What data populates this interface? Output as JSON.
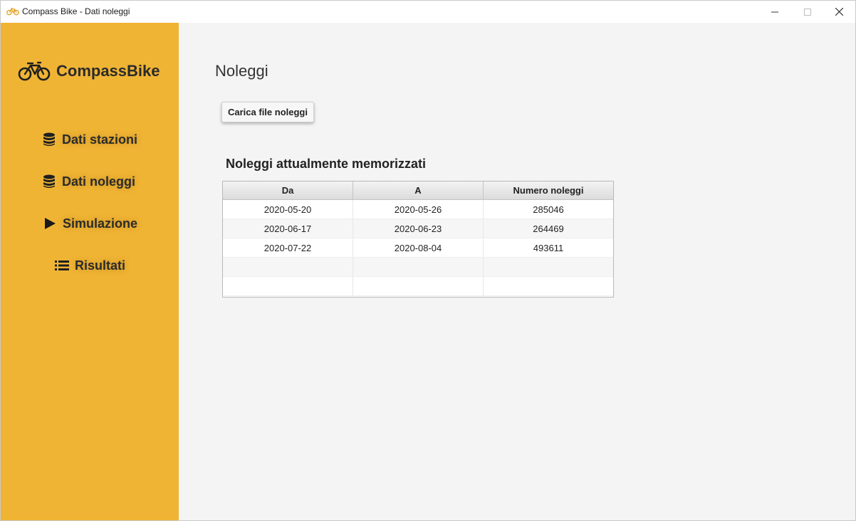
{
  "window": {
    "title": "Compass Bike - Dati noleggi"
  },
  "sidebar": {
    "brand": "CompassBike",
    "accent_color": "#f0b434",
    "items": [
      {
        "label": "Dati stazioni",
        "icon": "database-icon"
      },
      {
        "label": "Dati noleggi",
        "icon": "database-icon"
      },
      {
        "label": "Simulazione",
        "icon": "play-icon"
      },
      {
        "label": "Risultati",
        "icon": "list-icon"
      }
    ]
  },
  "main": {
    "title": "Noleggi",
    "load_button": "Carica file noleggi",
    "section_title": "Noleggi attualmente memorizzati",
    "table": {
      "columns": [
        "Da",
        "A",
        "Numero noleggi"
      ],
      "rows": [
        [
          "2020-05-20",
          "2020-05-26",
          "285046"
        ],
        [
          "2020-06-17",
          "2020-06-23",
          "264469"
        ],
        [
          "2020-07-22",
          "2020-08-04",
          "493611"
        ],
        [
          "",
          "",
          ""
        ],
        [
          "",
          "",
          ""
        ]
      ]
    }
  }
}
